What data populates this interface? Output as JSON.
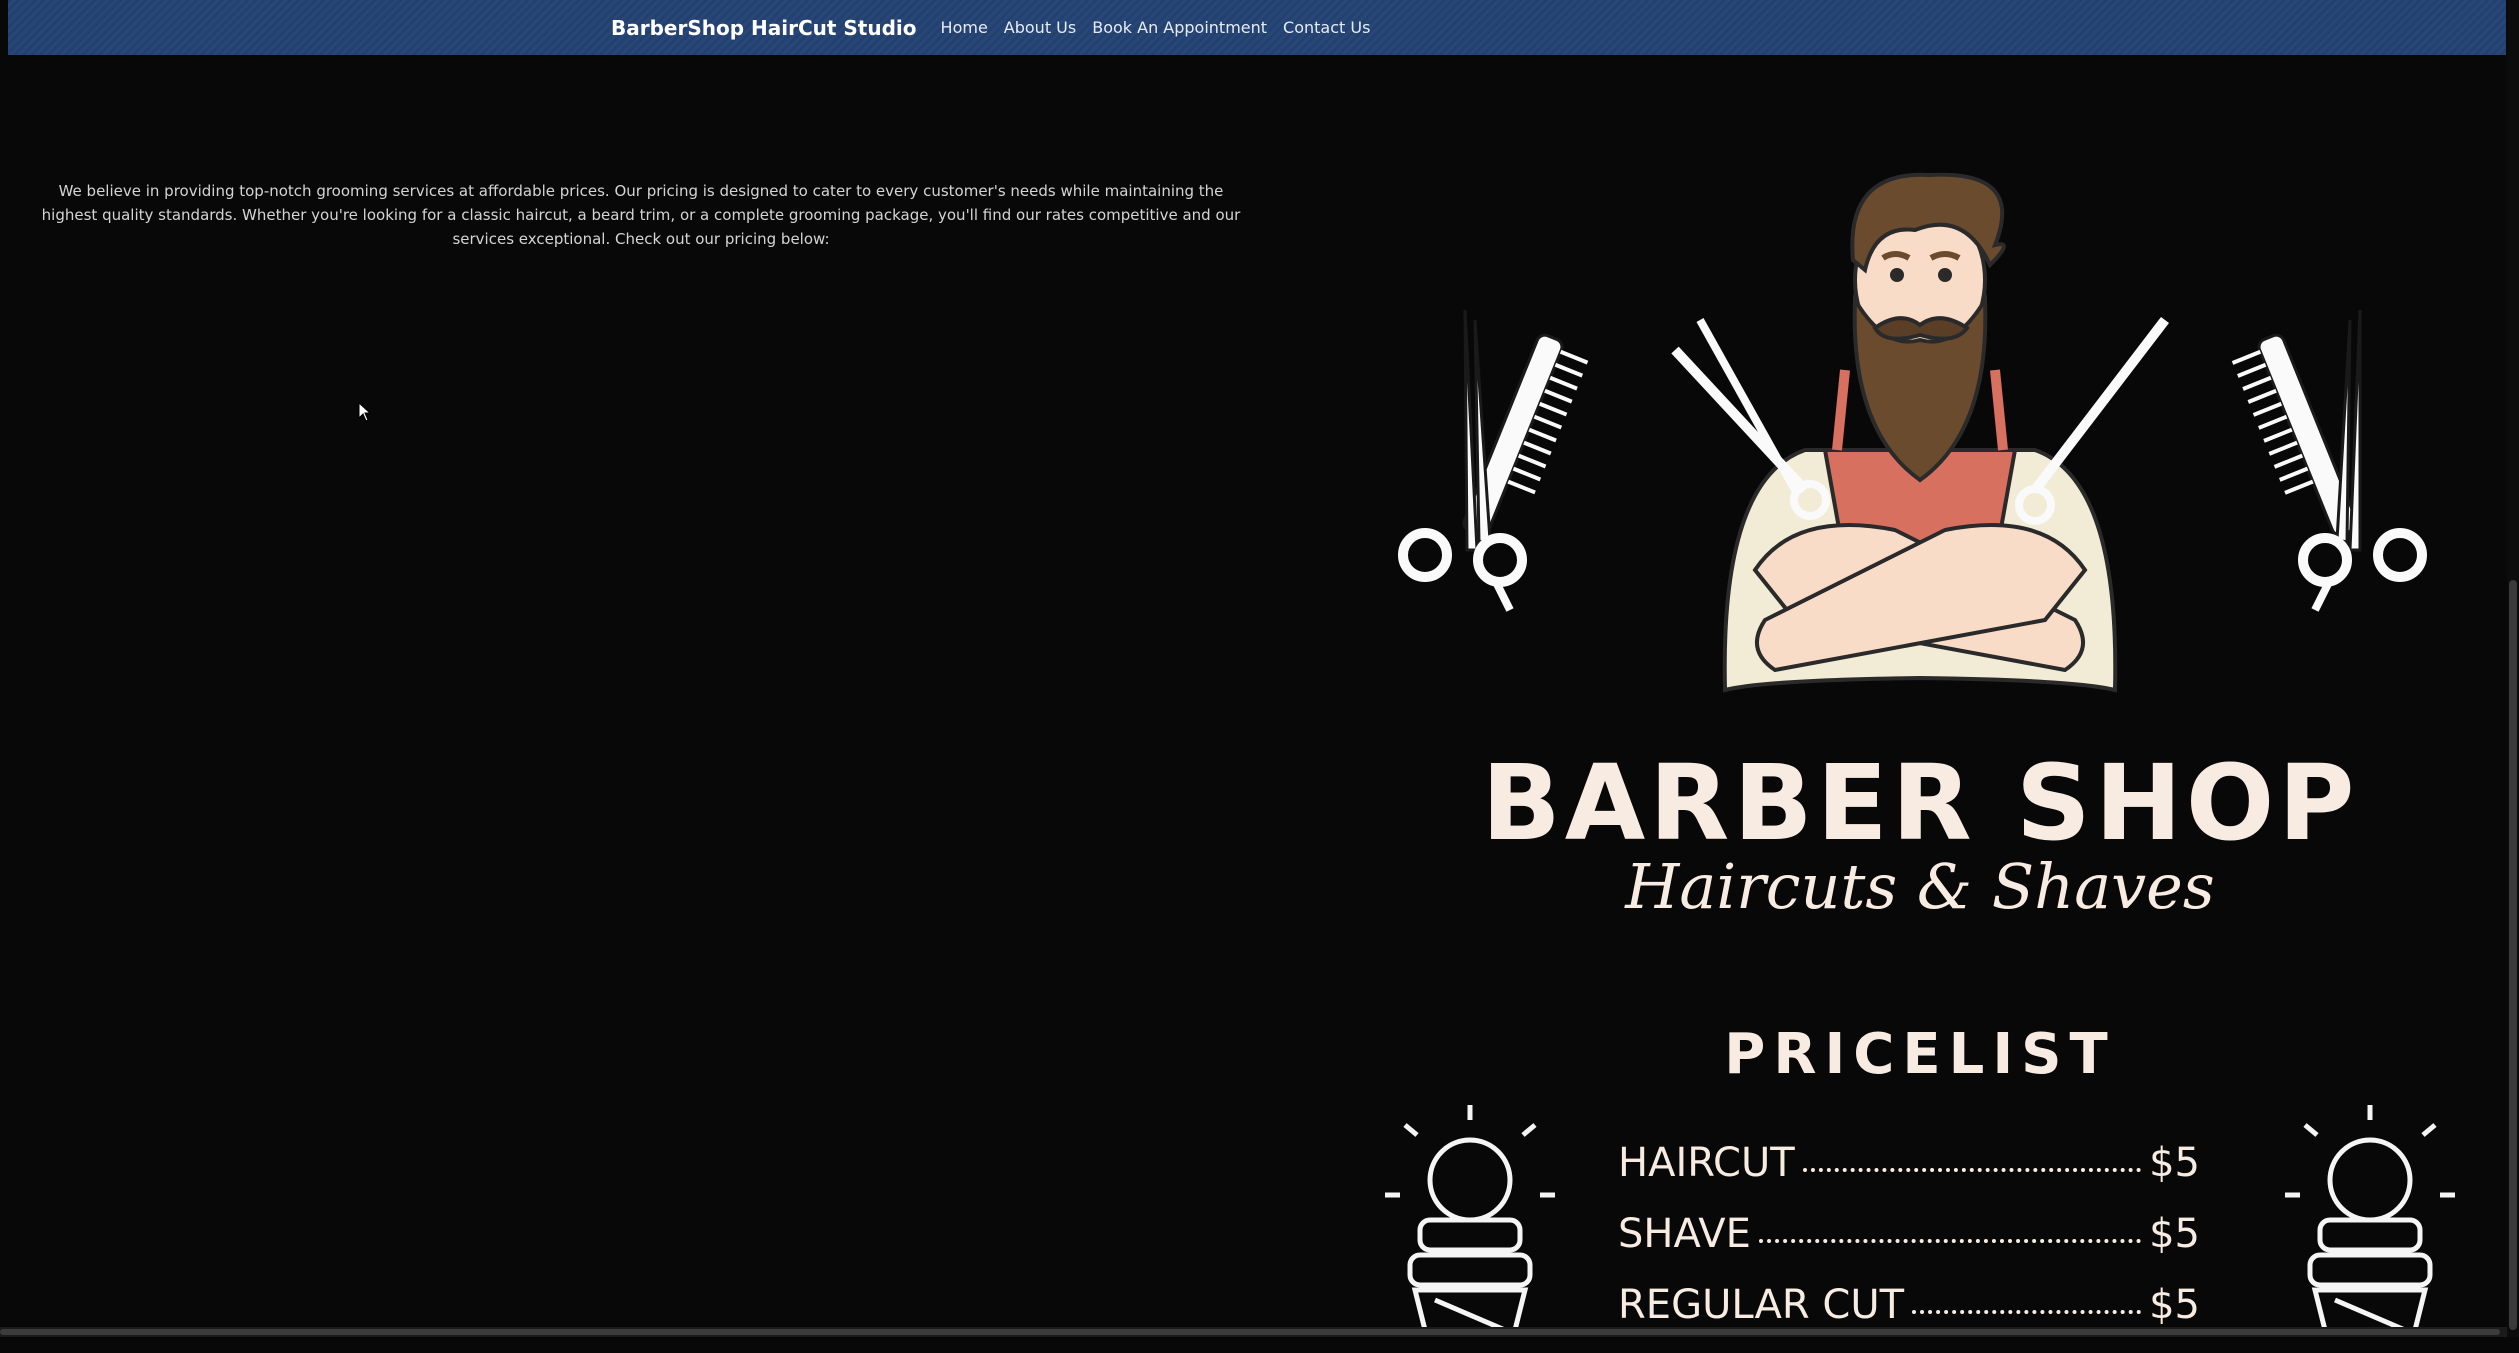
{
  "navbar": {
    "brand": "BarberShop HairCut Studio",
    "links": [
      "Home",
      "About Us",
      "Book An Appointment",
      "Contact Us"
    ]
  },
  "intro": {
    "text": "We believe in providing top-notch grooming services at affordable prices. Our pricing is designed to cater to every customer's needs while maintaining the highest quality standards. Whether you're looking for a classic haircut, a beard trim, or a complete grooming package, you'll find our rates competitive and our services exceptional. Check out our pricing below:"
  },
  "poster": {
    "title": "BARBER SHOP",
    "subtitle": "Haircuts & Shaves",
    "pricelist_heading": "PRICELIST",
    "items": [
      {
        "name": "HAIRCUT",
        "price": "$5"
      },
      {
        "name": "SHAVE",
        "price": "$5"
      },
      {
        "name": "REGULAR CUT",
        "price": "$5"
      }
    ],
    "colors": {
      "cream": "#f8ece2",
      "beard": "#6b4b2e",
      "apron": "#d8705f",
      "shirt": "#f2ecd6",
      "skin": "#f8dcc8"
    }
  },
  "theme": {
    "background": "#080808",
    "navbar": "#26436f"
  }
}
